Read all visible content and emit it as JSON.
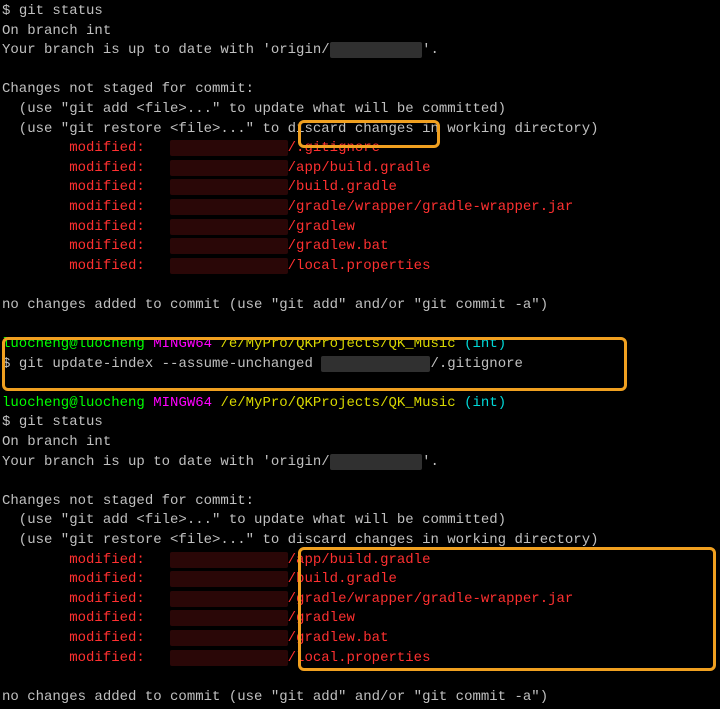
{
  "block1": {
    "prompt": "$ ",
    "cmd": "git status",
    "branch_line": "On branch int",
    "uptodate_pre": "Your branch is up to date with 'origin/",
    "uptodate_post": "'.",
    "changes_header": "Changes not staged for commit:",
    "hint1": "  (use \"git add <file>...\" to update what will be committed)",
    "hint2": "  (use \"git restore <file>...\" to discard changes in working directory)",
    "modified_label": "        modified:   ",
    "files": [
      "/.gitignore",
      "/app/build.gradle",
      "/build.gradle",
      "/gradle/wrapper/gradle-wrapper.jar",
      "/gradlew",
      "/gradlew.bat",
      "/local.properties"
    ],
    "no_changes": "no changes added to commit (use \"git add\" and/or \"git commit -a\")"
  },
  "ps1": {
    "user": "luocheng@luocheng",
    "mingw": "MINGW64",
    "path": "/e/MyPro/QKProjects/QK_Music",
    "branch": "(int)"
  },
  "update_cmd": {
    "prompt": "$ ",
    "cmd_pre": "git update-index --assume-unchanged ",
    "cmd_post": "/.gitignore"
  },
  "block2": {
    "prompt": "$ ",
    "cmd": "git status",
    "branch_line": "On branch int",
    "uptodate_pre": "Your branch is up to date with 'origin/",
    "uptodate_post": "'.",
    "changes_header": "Changes not staged for commit:",
    "hint1": "  (use \"git add <file>...\" to update what will be committed)",
    "hint2": "  (use \"git restore <file>...\" to discard changes in working directory)",
    "modified_label": "        modified:   ",
    "files": [
      "/app/build.gradle",
      "/build.gradle",
      "/gradle/wrapper/gradle-wrapper.jar",
      "/gradlew",
      "/gradlew.bat",
      "/local.properties"
    ],
    "no_changes": "no changes added to commit (use \"git add\" and/or \"git commit -a\")"
  }
}
